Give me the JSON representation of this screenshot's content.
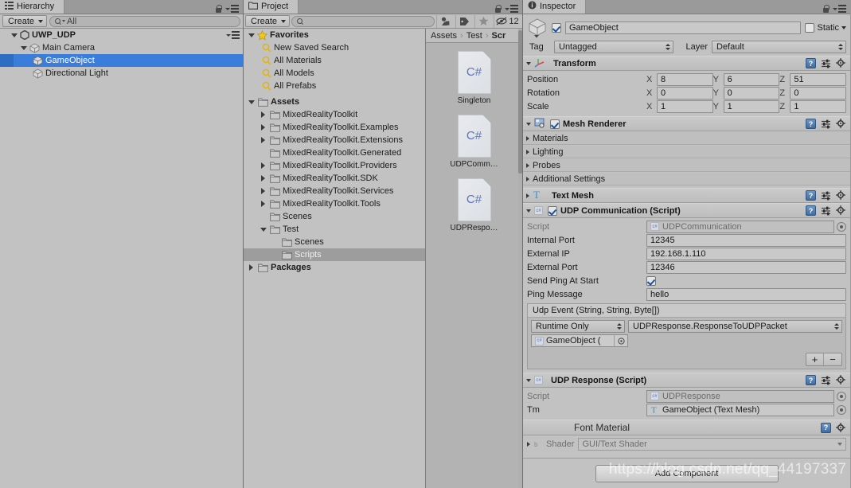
{
  "hierarchy": {
    "tab_label": "Hierarchy",
    "create_label": "Create",
    "search_placeholder": "All",
    "search_value": "All",
    "items": [
      {
        "label": "UWP_UDP",
        "depth": 0,
        "icon": "unity-scene-icon",
        "expanded": true,
        "selected": false
      },
      {
        "label": "Main Camera",
        "depth": 1,
        "icon": "gameobject-cube-icon",
        "expanded": true,
        "selected": false
      },
      {
        "label": "GameObject",
        "depth": 2,
        "icon": "gameobject-cube-icon",
        "expanded": false,
        "selected": true
      },
      {
        "label": "Directional Light",
        "depth": 1,
        "icon": "gameobject-cube-icon",
        "expanded": false,
        "selected": false
      }
    ]
  },
  "project": {
    "tab_label": "Project",
    "create_label": "Create",
    "search_placeholder": "",
    "hidden_count": "12",
    "favorites": {
      "label": "Favorites",
      "items": [
        "New Saved Search",
        "All Materials",
        "All Models",
        "All Prefabs"
      ]
    },
    "tree": [
      {
        "label": "Assets",
        "depth": 0,
        "expanded": true,
        "arrow": true,
        "bold": true,
        "selected": false
      },
      {
        "label": "MixedRealityToolkit",
        "depth": 1,
        "expanded": false,
        "arrow": true,
        "bold": false,
        "selected": false
      },
      {
        "label": "MixedRealityToolkit.Examples",
        "depth": 1,
        "expanded": false,
        "arrow": true,
        "bold": false,
        "selected": false
      },
      {
        "label": "MixedRealityToolkit.Extensions",
        "depth": 1,
        "expanded": false,
        "arrow": true,
        "bold": false,
        "selected": false
      },
      {
        "label": "MixedRealityToolkit.Generated",
        "depth": 1,
        "expanded": false,
        "arrow": false,
        "bold": false,
        "selected": false
      },
      {
        "label": "MixedRealityToolkit.Providers",
        "depth": 1,
        "expanded": false,
        "arrow": true,
        "bold": false,
        "selected": false
      },
      {
        "label": "MixedRealityToolkit.SDK",
        "depth": 1,
        "expanded": false,
        "arrow": true,
        "bold": false,
        "selected": false
      },
      {
        "label": "MixedRealityToolkit.Services",
        "depth": 1,
        "expanded": false,
        "arrow": true,
        "bold": false,
        "selected": false
      },
      {
        "label": "MixedRealityToolkit.Tools",
        "depth": 1,
        "expanded": false,
        "arrow": true,
        "bold": false,
        "selected": false
      },
      {
        "label": "Scenes",
        "depth": 1,
        "expanded": false,
        "arrow": false,
        "bold": false,
        "selected": false
      },
      {
        "label": "Test",
        "depth": 1,
        "expanded": true,
        "arrow": true,
        "bold": false,
        "selected": false
      },
      {
        "label": "Scenes",
        "depth": 2,
        "expanded": false,
        "arrow": false,
        "bold": false,
        "selected": false
      },
      {
        "label": "Scripts",
        "depth": 2,
        "expanded": false,
        "arrow": false,
        "bold": false,
        "selected": true
      },
      {
        "label": "Packages",
        "depth": 0,
        "expanded": false,
        "arrow": true,
        "bold": true,
        "selected": false
      }
    ],
    "breadcrumb": [
      "Assets",
      "Test",
      "Scr"
    ],
    "assets": [
      {
        "name": "Singleton",
        "type": "C#"
      },
      {
        "name": "UDPComm…",
        "type": "C#"
      },
      {
        "name": "UDPRespo…",
        "type": "C#"
      }
    ]
  },
  "inspector": {
    "tab_label": "Inspector",
    "gameobject": {
      "enabled": true,
      "name": "GameObject",
      "static_label": "Static",
      "static_checked": false,
      "tag_label": "Tag",
      "tag_value": "Untagged",
      "layer_label": "Layer",
      "layer_value": "Default"
    },
    "transform": {
      "title": "Transform",
      "rows": [
        {
          "name": "Position",
          "x": "8",
          "y": "6",
          "z": "51"
        },
        {
          "name": "Rotation",
          "x": "0",
          "y": "0",
          "z": "0"
        },
        {
          "name": "Scale",
          "x": "1",
          "y": "1",
          "z": "1"
        }
      ],
      "axis_labels": [
        "X",
        "Y",
        "Z"
      ]
    },
    "mesh_renderer": {
      "title": "Mesh Renderer",
      "enabled": true,
      "sections": [
        "Materials",
        "Lighting",
        "Probes",
        "Additional Settings"
      ]
    },
    "text_mesh": {
      "title": "Text Mesh",
      "expanded": false
    },
    "udp_communication": {
      "title": "UDP Communication (Script)",
      "enabled": true,
      "script_label": "Script",
      "script_value": "UDPCommunication",
      "fields": [
        {
          "label": "Internal Port",
          "value": "12345",
          "type": "text"
        },
        {
          "label": "External IP",
          "value": "192.168.1.110",
          "type": "text"
        },
        {
          "label": "External Port",
          "value": "12346",
          "type": "text"
        },
        {
          "label": "Send Ping At Start",
          "value": "",
          "type": "checkbox",
          "checked": true
        },
        {
          "label": "Ping Message",
          "value": "hello",
          "type": "text"
        }
      ],
      "event": {
        "title": "Udp Event (String, String, Byte[])",
        "mode": "Runtime Only",
        "function": "UDPResponse.ResponseToUDPPacket",
        "target": "GameObject (",
        "add_label": "+",
        "remove_label": "−"
      }
    },
    "udp_response": {
      "title": "UDP Response (Script)",
      "script_label": "Script",
      "script_value": "UDPResponse",
      "tm_label": "Tm",
      "tm_value": "GameObject (Text Mesh)"
    },
    "font_material": {
      "title": "Font Material",
      "shader_label": "Shader",
      "shader_value": "GUI/Text Shader"
    },
    "add_component_label": "Add Component"
  },
  "watermark": "https://blog.csdn.net/qq_44197337",
  "colors": {
    "selection_blue": "#3a7ddb",
    "panel_bg": "#c2c2c2",
    "header_bg": "#bdbdbd",
    "csharp_blue": "#5a74c0"
  }
}
